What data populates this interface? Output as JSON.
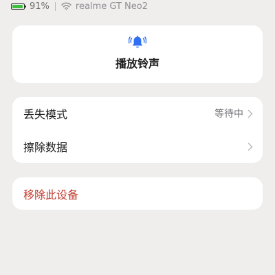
{
  "status_bar": {
    "battery_percent": "91%",
    "battery_level": 0.91,
    "device_name": "realme GT Neo2"
  },
  "ring_card": {
    "icon": "bell-ringing-icon",
    "label": "播放铃声"
  },
  "options": [
    {
      "label": "丢失模式",
      "value": "等待中"
    },
    {
      "label": "擦除数据",
      "value": ""
    }
  ],
  "remove": {
    "label": "移除此设备"
  },
  "colors": {
    "accent": "#2f6ff2",
    "danger": "#c0392b",
    "battery": "#3fbf40",
    "background": "#efeeed",
    "card": "#ffffff"
  }
}
